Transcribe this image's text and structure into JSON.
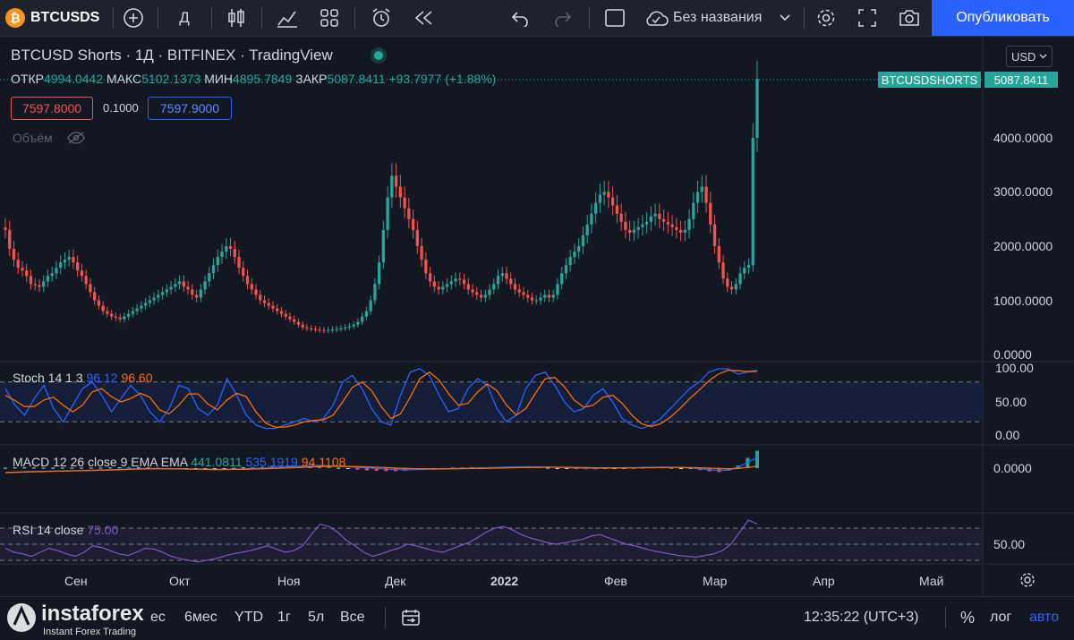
{
  "toolbar": {
    "symbol": "BTCUSDS",
    "symbol_logo": "₿",
    "interval": "Д",
    "layout_name": "Без названия",
    "publish_label": "Опубликовать",
    "icons": [
      "plus-icon",
      "candles-icon",
      "indicators-icon",
      "templates-icon",
      "alert-icon",
      "replay-icon",
      "undo-icon",
      "redo-icon",
      "fullscreen-box-icon",
      "cloud-icon",
      "chevron-down-icon",
      "settings-icon",
      "expand-icon",
      "camera-icon"
    ]
  },
  "legend": {
    "title": "BTCUSD Shorts · 1Д · BITFINEX · TradingView",
    "o_label": "ОТКР",
    "o": "4994.0442",
    "h_label": "МАКС",
    "h": "5102.1373",
    "l_label": "МИН",
    "l": "4895.7849",
    "c_label": "ЗАКР",
    "c": "5087.8411",
    "change": "+93.7977 (+1.88%)",
    "bid": "7597.8000",
    "spread": "0.1000",
    "ask": "7597.9000",
    "volume_label": "Объём"
  },
  "price_axis": {
    "currency": "USD",
    "symbol_badge": "BTCUSDSHORTS",
    "last_price": "5087.8411",
    "ticks": [
      "4000.0000",
      "3000.0000",
      "2000.0000",
      "1000.0000",
      "0.0000"
    ]
  },
  "stoch": {
    "label": "Stoch 14 1 3",
    "k": "96.12",
    "d": "96.60",
    "ticks": [
      "100.00",
      "50.00",
      "0.00"
    ]
  },
  "macd": {
    "label": "MACD 12 26 close 9 EMA EMA",
    "hist": "441.0811",
    "macd": "535.1919",
    "signal": "94.1108",
    "ticks": [
      "0.0000"
    ]
  },
  "rsi": {
    "label": "RSI 14 close",
    "value": "75.00",
    "ticks": [
      "50.00"
    ]
  },
  "time_axis": [
    "Сен",
    "Окт",
    "Ноя",
    "Дек",
    "2022",
    "Фев",
    "Мар",
    "Апр",
    "Май"
  ],
  "bottom": {
    "ranges": [
      "6мес",
      "YTD",
      "1г",
      "5л",
      "Все"
    ],
    "partial_range": "ес",
    "time": "12:35:22 (UTC+3)",
    "percent": "%",
    "log": "лог",
    "auto": "авто",
    "watermark": "instaforex",
    "watermark_sub": "Instant Forex Trading"
  },
  "colors": {
    "up": "#26a69a",
    "down": "#ef5350",
    "accent": "#2962ff",
    "stoch_k": "#2962ff",
    "stoch_d": "#ff6d00",
    "rsi": "#7e57c2"
  },
  "chart_data": {
    "type": "candlestick",
    "series": [
      {
        "name": "BTCUSD Shorts",
        "close": [
          2300,
          1950,
          1750,
          1600,
          1550,
          1450,
          1300,
          1280,
          1250,
          1350,
          1450,
          1500,
          1600,
          1700,
          1750,
          1800,
          1700,
          1550,
          1450,
          1300,
          1150,
          1000,
          900,
          800,
          750,
          700,
          680,
          650,
          700,
          750,
          800,
          850,
          900,
          950,
          1000,
          1050,
          1100,
          1150,
          1200,
          1250,
          1300,
          1350,
          1250,
          1200,
          1100,
          1050,
          1200,
          1350,
          1500,
          1650,
          1800,
          1900,
          2000,
          1950,
          1800,
          1600,
          1450,
          1300,
          1200,
          1100,
          1000,
          950,
          900,
          850,
          800,
          750,
          700,
          650,
          600,
          550,
          500,
          480,
          470,
          460,
          450,
          440,
          450,
          460,
          470,
          480,
          500,
          520,
          550,
          600,
          700,
          800,
          1000,
          1300,
          1700,
          2300,
          2900,
          3300,
          3100,
          2900,
          2700,
          2500,
          2300,
          2000,
          1750,
          1500,
          1350,
          1250,
          1200,
          1250,
          1300,
          1350,
          1400,
          1380,
          1300,
          1200,
          1150,
          1100,
          1050,
          1100,
          1200,
          1300,
          1450,
          1500,
          1400,
          1300,
          1200,
          1150,
          1100,
          1050,
          1000,
          1000,
          1050,
          1100,
          1050,
          1100,
          1300,
          1500,
          1650,
          1800,
          1900,
          2000,
          2200,
          2400,
          2600,
          2800,
          2950,
          3000,
          2900,
          2750,
          2600,
          2450,
          2300,
          2250,
          2300,
          2350,
          2400,
          2450,
          2550,
          2600,
          2500,
          2450,
          2400,
          2350,
          2300,
          2250,
          2300,
          2500,
          2800,
          3000,
          3100,
          2800,
          2400,
          2000,
          1700,
          1400,
          1250,
          1200,
          1300,
          1500,
          1600,
          1650,
          4000,
          5088
        ]
      }
    ],
    "stoch_k": [
      70,
      45,
      30,
      55,
      75,
      40,
      20,
      45,
      70,
      80,
      60,
      35,
      55,
      75,
      60,
      35,
      20,
      40,
      75,
      70,
      40,
      30,
      45,
      85,
      60,
      30,
      15,
      10,
      10,
      15,
      20,
      25,
      20,
      25,
      45,
      80,
      90,
      70,
      40,
      20,
      15,
      60,
      95,
      100,
      90,
      60,
      35,
      40,
      70,
      85,
      75,
      40,
      20,
      30,
      70,
      90,
      95,
      75,
      50,
      35,
      40,
      60,
      70,
      50,
      25,
      15,
      10,
      15,
      25,
      40,
      55,
      70,
      80,
      95,
      100,
      100,
      92,
      95,
      96
    ],
    "stoch_d": [
      60,
      52,
      43,
      43,
      53,
      57,
      45,
      35,
      45,
      65,
      70,
      58,
      50,
      55,
      63,
      57,
      38,
      32,
      45,
      62,
      62,
      47,
      38,
      53,
      63,
      58,
      35,
      18,
      12,
      12,
      15,
      20,
      22,
      23,
      30,
      50,
      72,
      80,
      67,
      43,
      25,
      32,
      57,
      85,
      95,
      83,
      62,
      45,
      48,
      65,
      77,
      67,
      45,
      30,
      40,
      63,
      85,
      87,
      73,
      53,
      42,
      45,
      57,
      60,
      48,
      30,
      17,
      13,
      17,
      27,
      40,
      55,
      68,
      82,
      92,
      98,
      97,
      96,
      97
    ],
    "macd": [
      -220,
      -200,
      -180,
      -170,
      -160,
      -150,
      -140,
      -130,
      -120,
      -110,
      -100,
      -80,
      -60,
      -40,
      -30,
      -20,
      -25,
      -30,
      -40,
      -50,
      -60,
      -70,
      -80,
      -70,
      -60,
      -40,
      -20,
      0,
      30,
      60,
      80,
      100,
      120,
      130,
      120,
      100,
      70,
      40,
      10,
      -20,
      -50,
      -70,
      -80,
      -75,
      -65,
      -50,
      -35,
      -20,
      -10,
      0,
      10,
      25,
      40,
      55,
      65,
      70,
      65,
      55,
      40,
      25,
      10,
      0,
      -10,
      -5,
      5,
      15,
      25,
      35,
      45,
      50,
      45,
      30,
      10,
      -30,
      -80,
      -120,
      -100,
      50,
      300,
      535
    ],
    "signal": [
      -230,
      -215,
      -198,
      -185,
      -172,
      -160,
      -150,
      -140,
      -130,
      -120,
      -110,
      -96,
      -80,
      -64,
      -50,
      -38,
      -33,
      -31,
      -34,
      -40,
      -47,
      -56,
      -64,
      -66,
      -65,
      -58,
      -46,
      -34,
      -18,
      2,
      20,
      40,
      60,
      80,
      90,
      92,
      88,
      78,
      64,
      46,
      26,
      6,
      -12,
      -26,
      -34,
      -37,
      -37,
      -33,
      -27,
      -20,
      -12,
      -3,
      8,
      18,
      29,
      38,
      43,
      45,
      44,
      40,
      34,
      27,
      20,
      15,
      13,
      13,
      16,
      20,
      25,
      30,
      33,
      32,
      28,
      18,
      0,
      -20,
      -35,
      -18,
      40,
      94
    ],
    "rsi": [
      45,
      40,
      38,
      35,
      40,
      45,
      42,
      38,
      35,
      40,
      48,
      46,
      42,
      38,
      36,
      40,
      45,
      44,
      40,
      35,
      32,
      30,
      28,
      30,
      32,
      35,
      38,
      40,
      42,
      45,
      48,
      44,
      40,
      42,
      48,
      62,
      75,
      72,
      65,
      55,
      48,
      40,
      35,
      38,
      42,
      45,
      50,
      48,
      45,
      42,
      40,
      44,
      48,
      52,
      58,
      65,
      70,
      72,
      68,
      62,
      58,
      55,
      52,
      50,
      52,
      54,
      56,
      60,
      62,
      58,
      54,
      50,
      48,
      45,
      42,
      40,
      38,
      36,
      35,
      34,
      36,
      38,
      42,
      50,
      65,
      80,
      75
    ]
  }
}
